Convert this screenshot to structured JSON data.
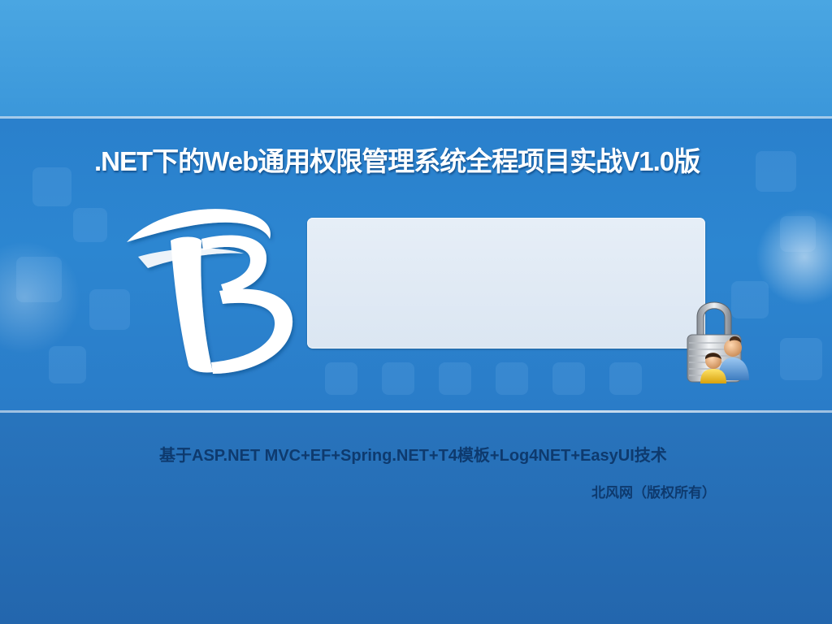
{
  "header": {
    "title": ".NET下的Web通用权限管理系统全程项目实战V1.0版"
  },
  "login_panel": {
    "state": "empty"
  },
  "footer": {
    "subtitle": "基于ASP.NET MVC+EF+Spring.NET+T4模板+Log4NET+EasyUI技术",
    "copyright": "北风网（版权所有）"
  },
  "icons": {
    "logo": "letter-b-logo",
    "lock": "padlock-users-icon"
  },
  "colors": {
    "background_top": "#45a2e0",
    "background_bottom": "#2366ad",
    "title_text": "#ffffff",
    "footer_text": "#0e3a6e",
    "panel": "#e0e9f4"
  }
}
